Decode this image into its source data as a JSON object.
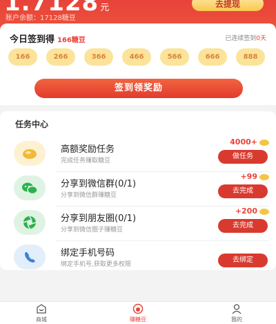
{
  "header": {
    "balance_main": "1.7128",
    "balance_unit": "元",
    "account_balance": "账户余额：17128糖豆",
    "withdraw_label": "去提现"
  },
  "signin": {
    "title": "今日签到得",
    "today_amount": "166糖豆",
    "streak_prefix": "已连续签到",
    "streak_days": "0天",
    "rewards": [
      "166",
      "266",
      "366",
      "466",
      "566",
      "666",
      "888"
    ],
    "sign_button": "签到领奖励"
  },
  "tasks": {
    "header": "任务中心",
    "items": [
      {
        "icon": "bean-icon",
        "title": "高额奖励任务",
        "desc": "完成任务赚取糖豆",
        "reward": "4000+",
        "button": "做任务"
      },
      {
        "icon": "wechat-icon",
        "title": "分享到微信群(0/1)",
        "desc": "分享到微信群赚糖豆",
        "reward": "+99",
        "button": "去完成"
      },
      {
        "icon": "moments-icon",
        "title": "分享到朋友圈(0/1)",
        "desc": "分享到微信圈子赚糖豆",
        "reward": "+200",
        "button": "去完成"
      },
      {
        "icon": "phone-icon",
        "title": "绑定手机号码",
        "desc": "绑定手机号,获取更多权限",
        "reward": "",
        "button": "去绑定"
      }
    ]
  },
  "nav": {
    "items": [
      {
        "label": "商城",
        "icon": "store-icon"
      },
      {
        "label": "赚糖豆",
        "icon": "earn-icon"
      },
      {
        "label": "我的",
        "icon": "profile-icon"
      }
    ]
  },
  "colors": {
    "accent": "#e8433a",
    "coin": "#fbe39a",
    "wechat": "#2bb24c"
  }
}
